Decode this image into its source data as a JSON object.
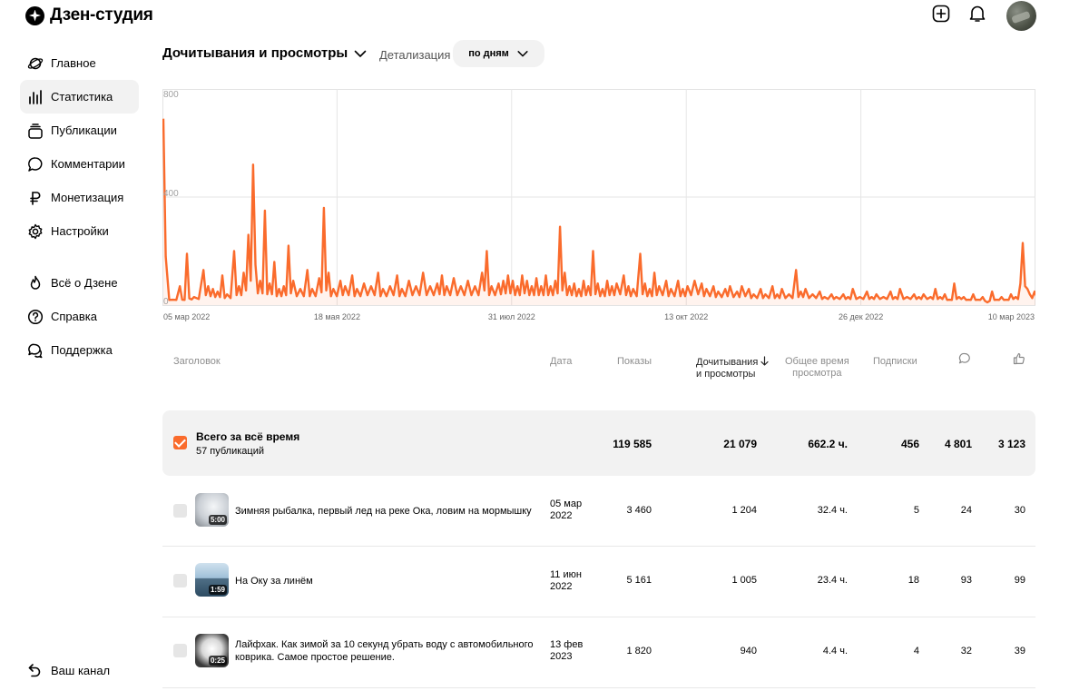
{
  "app": {
    "title": "Дзен-студия"
  },
  "sidebar": {
    "items": [
      {
        "label": "Главное",
        "icon": "planet-icon"
      },
      {
        "label": "Статистика",
        "icon": "bar-chart-icon",
        "active": true
      },
      {
        "label": "Публикации",
        "icon": "stack-icon"
      },
      {
        "label": "Комментарии",
        "icon": "comment-icon"
      },
      {
        "label": "Монетизация",
        "icon": "ruble-icon"
      },
      {
        "label": "Настройки",
        "icon": "gear-icon"
      }
    ],
    "secondary": [
      {
        "label": "Всё о Дзене",
        "icon": "flame-icon"
      },
      {
        "label": "Справка",
        "icon": "help-icon"
      },
      {
        "label": "Поддержка",
        "icon": "support-chat-icon"
      }
    ],
    "channel_label": "Ваш канал"
  },
  "toolbar": {
    "metric": "Дочитывания и просмотры",
    "detail_label": "Детализация",
    "detail_value": "по дням"
  },
  "chart_data": {
    "type": "area",
    "ylim": [
      0,
      800
    ],
    "y_ticks": [
      "800",
      "400",
      "0"
    ],
    "x_ticks": [
      "05 мар 2022",
      "18 мая 2022",
      "31 июл 2022",
      "13 окт 2022",
      "26 дек 2022",
      "10 мар 2023"
    ],
    "x_start": "2022-03-05",
    "x_end": "2023-03-10",
    "grid": true,
    "color": "#fa6b2c",
    "peaks": [
      [
        0,
        690
      ],
      [
        1,
        180
      ],
      [
        4,
        20
      ],
      [
        7,
        70
      ],
      [
        8,
        20
      ],
      [
        10,
        190
      ],
      [
        11,
        25
      ],
      [
        13,
        30
      ],
      [
        17,
        130
      ],
      [
        19,
        70
      ],
      [
        21,
        60
      ],
      [
        23,
        50
      ],
      [
        25,
        110
      ],
      [
        27,
        40
      ],
      [
        30,
        200
      ],
      [
        32,
        70
      ],
      [
        34,
        120
      ],
      [
        36,
        260
      ],
      [
        37,
        90
      ],
      [
        38,
        520
      ],
      [
        39,
        150
      ],
      [
        41,
        90
      ],
      [
        43,
        350
      ],
      [
        45,
        80
      ],
      [
        47,
        160
      ],
      [
        49,
        60
      ],
      [
        51,
        70
      ],
      [
        53,
        220
      ],
      [
        55,
        90
      ],
      [
        58,
        60
      ],
      [
        61,
        130
      ],
      [
        63,
        60
      ],
      [
        66,
        100
      ],
      [
        68,
        360
      ],
      [
        70,
        120
      ],
      [
        72,
        60
      ],
      [
        75,
        90
      ],
      [
        77,
        70
      ],
      [
        80,
        110
      ],
      [
        82,
        60
      ],
      [
        85,
        80
      ],
      [
        88,
        70
      ],
      [
        91,
        120
      ],
      [
        93,
        60
      ],
      [
        96,
        70
      ],
      [
        99,
        110
      ],
      [
        101,
        60
      ],
      [
        104,
        90
      ],
      [
        107,
        70
      ],
      [
        110,
        120
      ],
      [
        113,
        70
      ],
      [
        116,
        80
      ],
      [
        118,
        110
      ],
      [
        120,
        70
      ],
      [
        123,
        100
      ],
      [
        126,
        70
      ],
      [
        129,
        90
      ],
      [
        132,
        70
      ],
      [
        135,
        120
      ],
      [
        137,
        200
      ],
      [
        139,
        70
      ],
      [
        142,
        80
      ],
      [
        144,
        90
      ],
      [
        146,
        110
      ],
      [
        148,
        90
      ],
      [
        150,
        70
      ],
      [
        152,
        110
      ],
      [
        154,
        90
      ],
      [
        156,
        70
      ],
      [
        158,
        100
      ],
      [
        160,
        70
      ],
      [
        162,
        110
      ],
      [
        164,
        70
      ],
      [
        166,
        90
      ],
      [
        168,
        290
      ],
      [
        170,
        120
      ],
      [
        172,
        70
      ],
      [
        174,
        80
      ],
      [
        176,
        60
      ],
      [
        178,
        90
      ],
      [
        180,
        70
      ],
      [
        182,
        200
      ],
      [
        184,
        80
      ],
      [
        186,
        60
      ],
      [
        188,
        90
      ],
      [
        190,
        70
      ],
      [
        192,
        80
      ],
      [
        195,
        110
      ],
      [
        197,
        70
      ],
      [
        199,
        60
      ],
      [
        202,
        190
      ],
      [
        204,
        80
      ],
      [
        206,
        60
      ],
      [
        208,
        120
      ],
      [
        210,
        70
      ],
      [
        213,
        90
      ],
      [
        215,
        60
      ],
      [
        218,
        90
      ],
      [
        220,
        60
      ],
      [
        222,
        70
      ],
      [
        225,
        90
      ],
      [
        228,
        80
      ],
      [
        230,
        60
      ],
      [
        233,
        70
      ],
      [
        235,
        50
      ],
      [
        238,
        60
      ],
      [
        240,
        70
      ],
      [
        243,
        50
      ],
      [
        245,
        70
      ],
      [
        248,
        60
      ],
      [
        250,
        40
      ],
      [
        253,
        60
      ],
      [
        255,
        40
      ],
      [
        258,
        70
      ],
      [
        260,
        40
      ],
      [
        262,
        60
      ],
      [
        265,
        40
      ],
      [
        268,
        130
      ],
      [
        270,
        50
      ],
      [
        272,
        60
      ],
      [
        275,
        40
      ],
      [
        278,
        50
      ],
      [
        280,
        30
      ],
      [
        283,
        40
      ],
      [
        285,
        30
      ],
      [
        288,
        40
      ],
      [
        290,
        30
      ],
      [
        292,
        60
      ],
      [
        295,
        30
      ],
      [
        298,
        50
      ],
      [
        300,
        30
      ],
      [
        302,
        40
      ],
      [
        305,
        30
      ],
      [
        308,
        50
      ],
      [
        310,
        30
      ],
      [
        312,
        60
      ],
      [
        315,
        30
      ],
      [
        318,
        40
      ],
      [
        320,
        30
      ],
      [
        322,
        40
      ],
      [
        325,
        30
      ],
      [
        327,
        60
      ],
      [
        329,
        30
      ],
      [
        331,
        40
      ],
      [
        333,
        20
      ],
      [
        335,
        80
      ],
      [
        337,
        30
      ],
      [
        339,
        30
      ],
      [
        341,
        20
      ],
      [
        343,
        40
      ],
      [
        345,
        20
      ],
      [
        347,
        30
      ],
      [
        349,
        10
      ],
      [
        351,
        50
      ],
      [
        353,
        20
      ],
      [
        355,
        30
      ],
      [
        357,
        20
      ],
      [
        359,
        40
      ],
      [
        361,
        30
      ],
      [
        363,
        80
      ],
      [
        364,
        230
      ],
      [
        365,
        70
      ],
      [
        366,
        60
      ],
      [
        367,
        40
      ],
      [
        369,
        50
      ],
      [
        371,
        80
      ],
      [
        373,
        60
      ],
      [
        375,
        230
      ],
      [
        376,
        60
      ],
      [
        377,
        50
      ],
      [
        379,
        40
      ],
      [
        381,
        70
      ],
      [
        383,
        40
      ],
      [
        385,
        30
      ],
      [
        386,
        40
      ]
    ]
  },
  "table": {
    "headers": {
      "title": "Заголовок",
      "date": "Дата",
      "impressions": "Показы",
      "reads_line1": "Дочитывания",
      "reads_line2": "и просмотры",
      "watchtime_line1": "Общее время",
      "watchtime_line2": "просмотра",
      "subs": "Подписки"
    },
    "total": {
      "title": "Всего за всё время",
      "subtitle": "57 публикаций",
      "impressions": "119 585",
      "reads": "21 079",
      "watchtime": "662.2 ч.",
      "subs": "456",
      "comments": "4 801",
      "likes": "3 123"
    },
    "rows": [
      {
        "title": "Зимняя рыбалка, первый лед на реке Ока, ловим на мормышку",
        "duration": "5:00",
        "date_line1": "05 мар",
        "date_line2": "2022",
        "impressions": "3 460",
        "reads": "1 204",
        "watchtime": "32.4 ч.",
        "subs": "5",
        "comments": "24",
        "likes": "30"
      },
      {
        "title": "На Оку за линём",
        "duration": "1:59",
        "date_line1": "11 июн",
        "date_line2": "2022",
        "impressions": "5 161",
        "reads": "1 005",
        "watchtime": "23.4 ч.",
        "subs": "18",
        "comments": "93",
        "likes": "99"
      },
      {
        "title_line1": "Лайфхак. Как зимой за 10 секунд убрать воду с автомобильного",
        "title_line2": "коврика. Самое простое решение.",
        "duration": "0:25",
        "date_line1": "13 фев",
        "date_line2": "2023",
        "impressions": "1 820",
        "reads": "940",
        "watchtime": "4.4 ч.",
        "subs": "4",
        "comments": "32",
        "likes": "39"
      }
    ]
  },
  "colors": {
    "accent": "#fa6b2c",
    "active_bg": "#f2f2f2",
    "muted_text": "#8d8d8d"
  }
}
